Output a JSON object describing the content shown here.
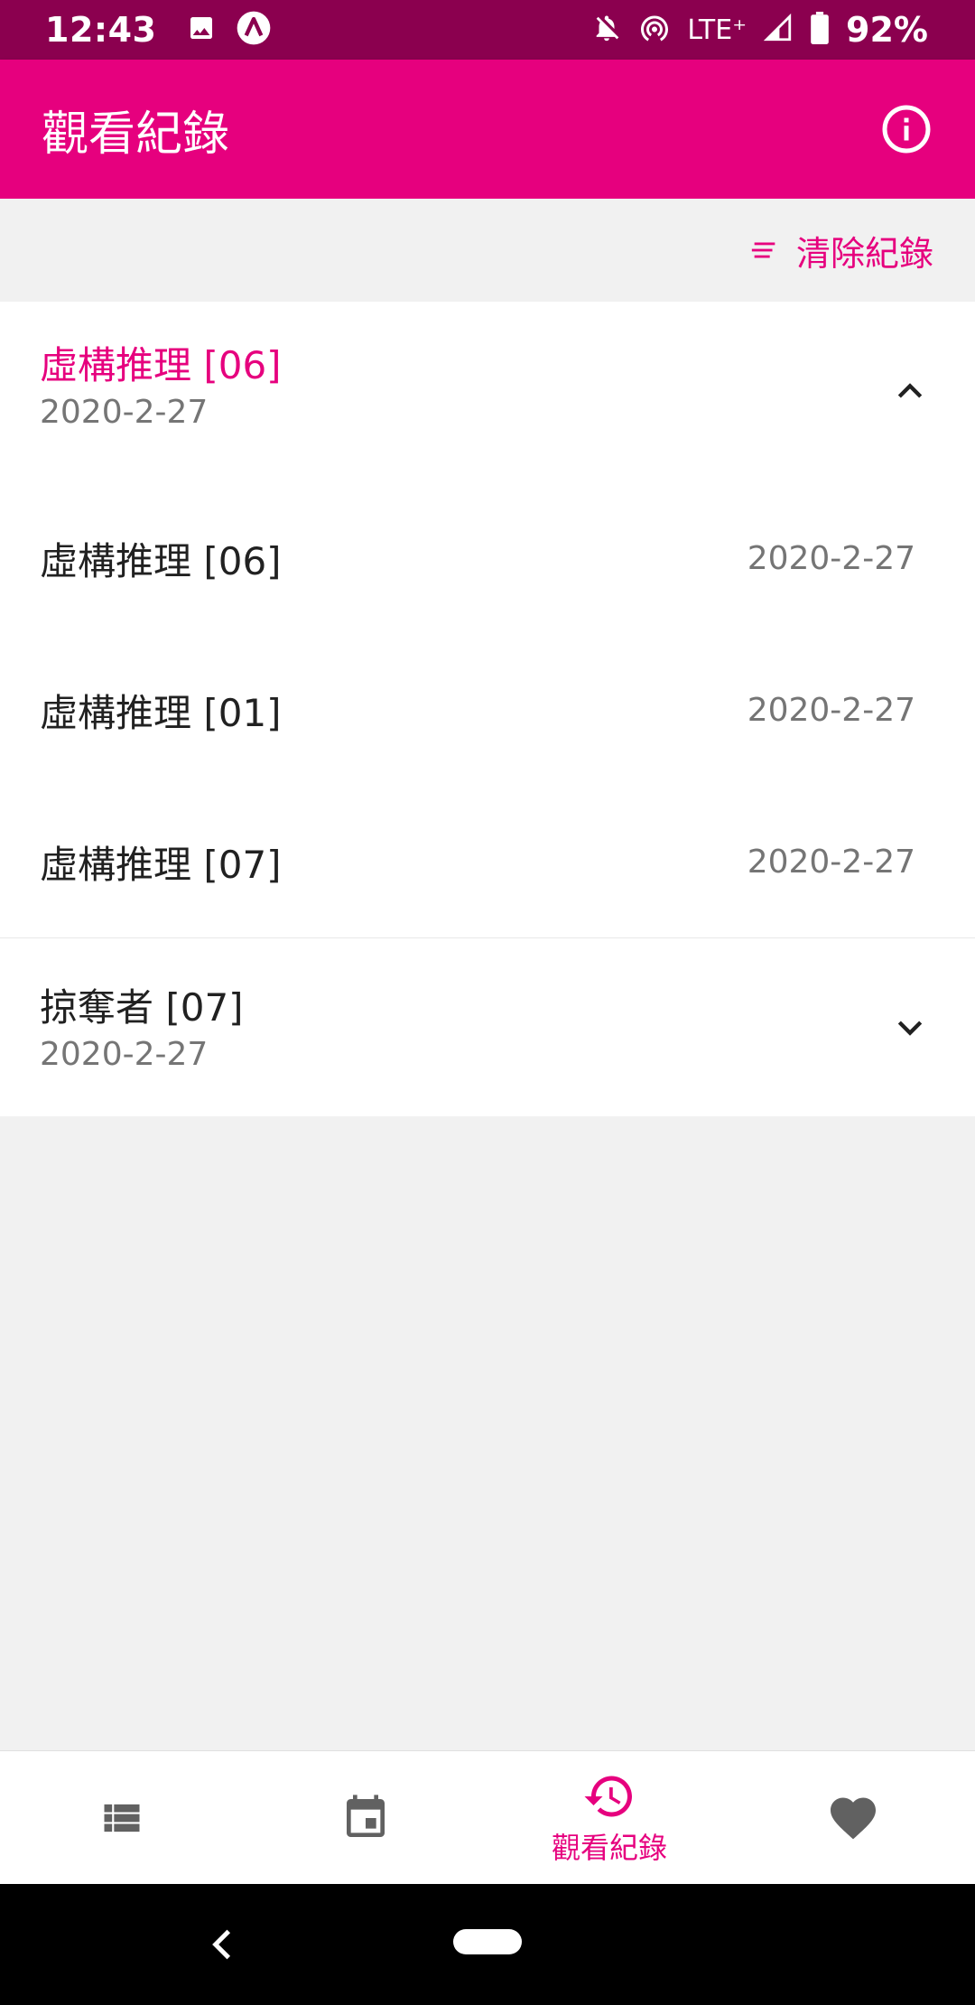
{
  "status_bar": {
    "time": "12:43",
    "network": "LTE⁺",
    "battery": "92%",
    "icons": [
      "image-icon",
      "app-a-icon",
      "notifications-off-icon",
      "hotspot-icon",
      "signal-icon",
      "battery-icon"
    ]
  },
  "app_bar": {
    "title": "觀看紀錄",
    "info_icon": "info-icon",
    "background": "#e6007e"
  },
  "toolbar": {
    "clear_label": "清除紀錄",
    "clear_icon": "sort-lines-icon"
  },
  "groups": [
    {
      "title": "虛構推理 [06]",
      "date": "2020-2-27",
      "expanded": true,
      "items": [
        {
          "title": "虛構推理 [06]",
          "date": "2020-2-27"
        },
        {
          "title": "虛構推理 [01]",
          "date": "2020-2-27"
        },
        {
          "title": "虛構推理 [07]",
          "date": "2020-2-27"
        }
      ]
    },
    {
      "title": "掠奪者 [07]",
      "date": "2020-2-27",
      "expanded": false,
      "items": []
    }
  ],
  "bottom_nav": {
    "items": [
      {
        "icon": "list-icon",
        "label": ""
      },
      {
        "icon": "calendar-icon",
        "label": ""
      },
      {
        "icon": "history-icon",
        "label": "觀看紀錄",
        "active": true
      },
      {
        "icon": "heart-icon",
        "label": ""
      }
    ]
  },
  "colors": {
    "accent": "#e6007e",
    "status_bar": "#8b004f",
    "inactive_icon": "#616161"
  }
}
